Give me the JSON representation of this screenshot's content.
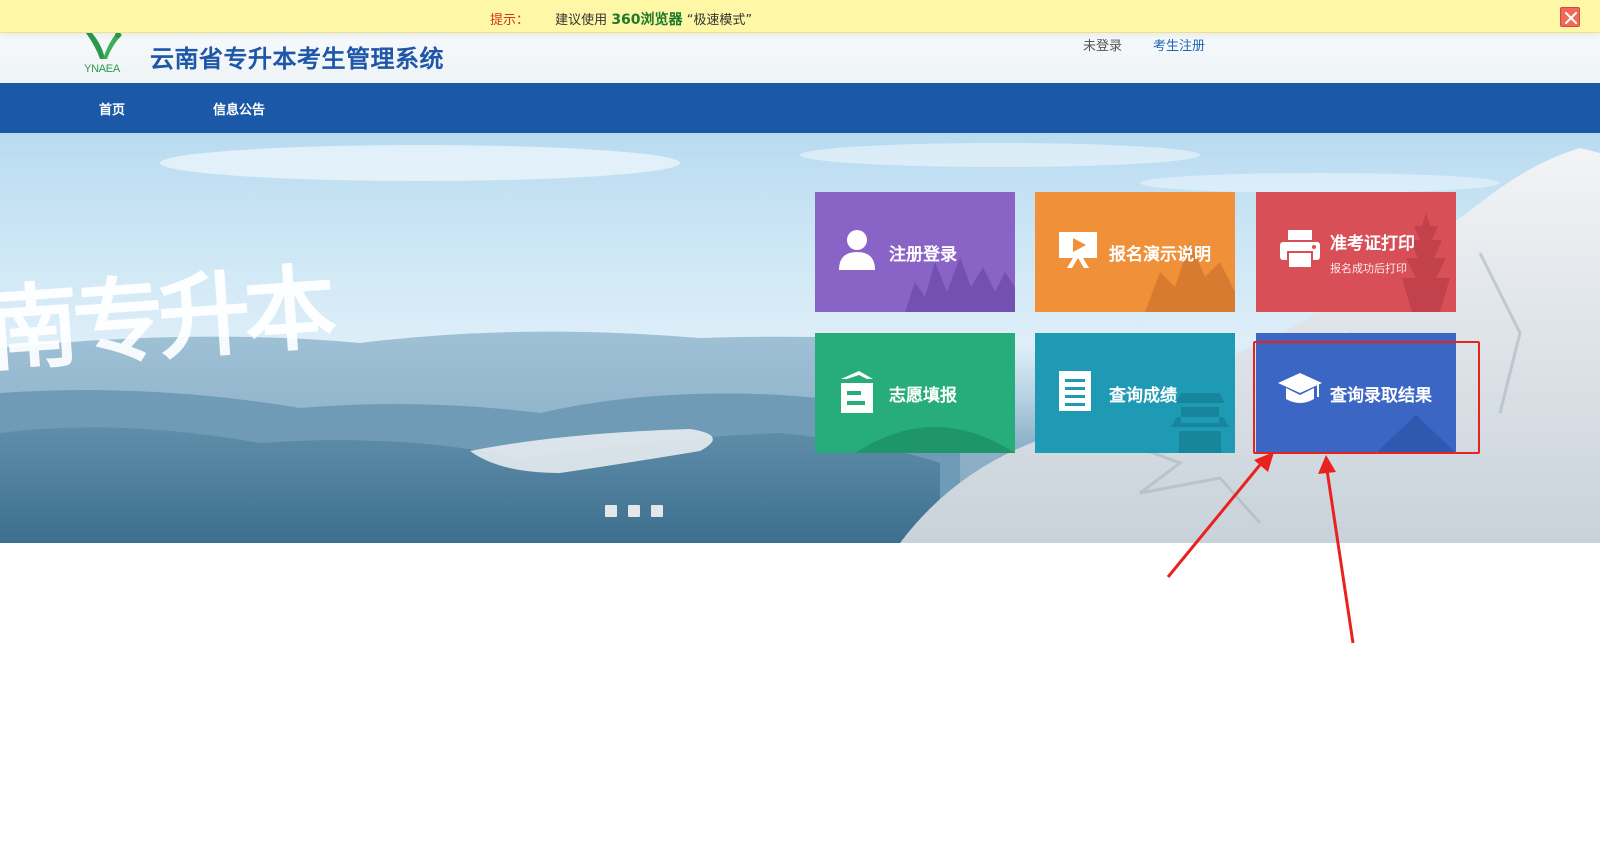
{
  "tipbar": {
    "label": "提示：",
    "prefix": "建议使用",
    "browser": "360浏览器",
    "suffix": "“极速模式”"
  },
  "header": {
    "logo_text": "YNAEA",
    "title": "云南省专升本考生管理系统",
    "user_status": "未登录",
    "register_link": "考生注册"
  },
  "nav": {
    "items": [
      {
        "label": "首页"
      },
      {
        "label": "信息公告"
      }
    ]
  },
  "banner": {
    "calligraphy": "南专升本"
  },
  "tiles": [
    {
      "title": "注册登录",
      "color": "#8a63c6",
      "icon": "user-icon"
    },
    {
      "title": "报名演示说明",
      "color": "#f0913a",
      "icon": "play-video-icon"
    },
    {
      "title": "准考证打印",
      "subtitle": "报名成功后打印",
      "color": "#d94f58",
      "icon": "printer-icon"
    },
    {
      "title": "志愿填报",
      "color": "#27ad7c",
      "icon": "form-fill-icon"
    },
    {
      "title": "查询成绩",
      "color": "#1f9ab4",
      "icon": "document-list-icon"
    },
    {
      "title": "查询录取结果",
      "color": "#3b66c4",
      "icon": "graduation-cap-icon"
    }
  ],
  "colors": {
    "tip_background": "#fdf7a6",
    "nav_background": "#1c58a8",
    "title_color": "#1e56a8",
    "highlight": "#e8231f"
  }
}
